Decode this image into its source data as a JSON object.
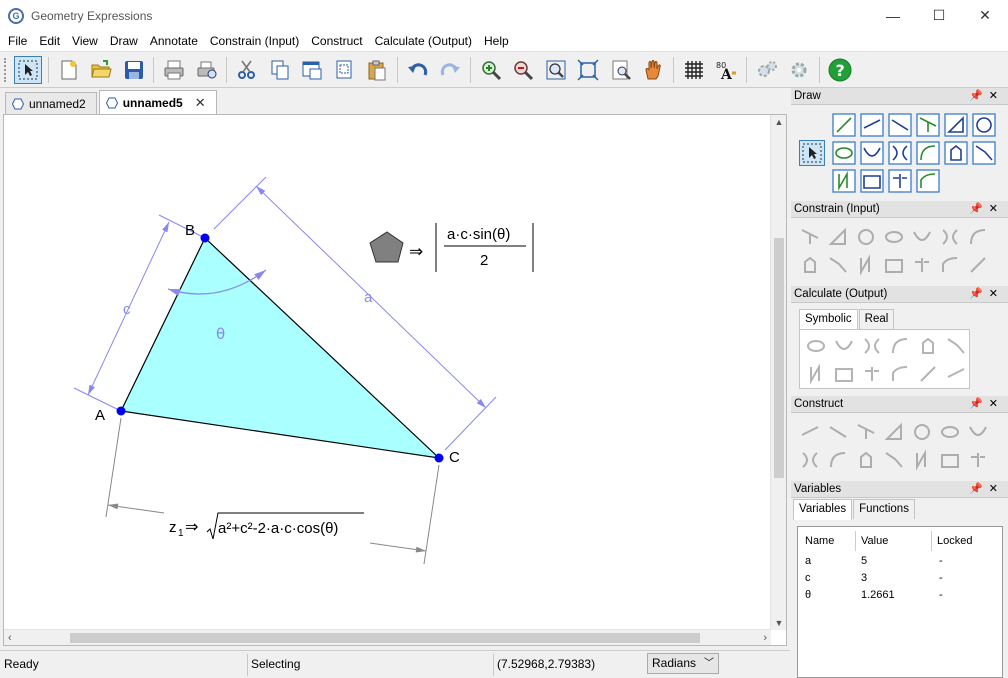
{
  "window": {
    "title": "Geometry Expressions",
    "app_icon_letter": "G",
    "minimize": "—",
    "maximize": "☐",
    "close": "✕"
  },
  "menu": [
    "File",
    "Edit",
    "View",
    "Draw",
    "Annotate",
    "Constrain (Input)",
    "Construct",
    "Calculate (Output)",
    "Help"
  ],
  "doc_tabs": [
    {
      "label": "unnamed2",
      "active": false
    },
    {
      "label": "unnamed5",
      "active": true,
      "close": "✕"
    }
  ],
  "drawing": {
    "points": [
      {
        "label": "A"
      },
      {
        "label": "B"
      },
      {
        "label": "C"
      }
    ],
    "side_labels": {
      "a": "a",
      "c": "c"
    },
    "angle_label": "θ",
    "area_expr": {
      "numerator": "a·c·sin(θ)",
      "denominator": "2",
      "arrow": "⇒"
    },
    "length_expr": {
      "name": "z",
      "subscript": "1",
      "arrow": "⇒",
      "radicand": "a²+c²-2·a·c·cos(θ)"
    },
    "colors": {
      "fill": "#aaffff",
      "point": "#0000ee",
      "dim": "#8888ee",
      "line": "#000000",
      "pentagon": "#808080"
    }
  },
  "status": {
    "ready": "Ready",
    "mode": "Selecting",
    "coords": "(7.52968,2.79383)",
    "angle_unit": "Radians"
  },
  "panels": {
    "draw": {
      "title": "Draw",
      "ctrls": "📌✕"
    },
    "constrain": {
      "title": "Constrain (Input)",
      "ctrls": "📌✕"
    },
    "calculate": {
      "title": "Calculate (Output)",
      "ctrls": "📌✕",
      "tabs": [
        "Symbolic",
        "Real"
      ]
    },
    "construct": {
      "title": "Construct",
      "ctrls": "📌✕"
    },
    "variables": {
      "title": "Variables",
      "ctrls": "📌✕",
      "tabs": [
        "Variables",
        "Functions"
      ],
      "columns": [
        "Name",
        "Value",
        "Locked"
      ],
      "rows": [
        {
          "name": "a",
          "value": "5",
          "locked": "-"
        },
        {
          "name": "c",
          "value": "3",
          "locked": "-"
        },
        {
          "name": "θ",
          "value": "1.2661",
          "locked": "-"
        }
      ]
    }
  }
}
